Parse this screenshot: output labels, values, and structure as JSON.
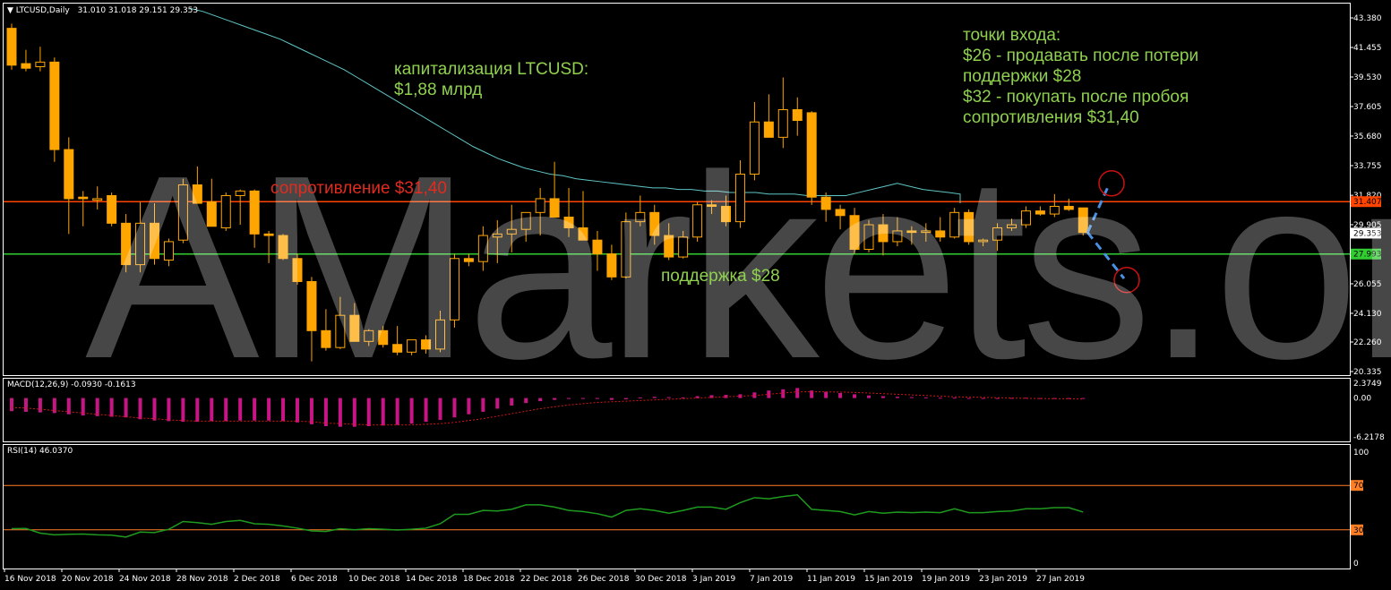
{
  "header": {
    "symbol_label": "LTCUSD,Daily",
    "ohlc": "31.010 31.018 29.151 29.353"
  },
  "watermark": "AMarkets.org",
  "annotations": {
    "cap_line1": "капитализация LTCUSD:",
    "cap_line2": "$1,88 млрд",
    "entry_lines": [
      "точки входа:",
      "$26 - продавать после потери",
      "поддержки $28",
      "$32 - покупать после пробоя",
      "сопротивления $31,40"
    ],
    "resistance_label": "сопротивление $31,40",
    "support_label": "поддержка $28"
  },
  "colors": {
    "bull_candle": "#000000",
    "candle": "#ffa500",
    "ma": "#5fc5c5",
    "resistance": "#ff4500",
    "support": "#32cd32",
    "macd_hist": "#c71585",
    "macd_signal": "#d01818",
    "rsi": "#1e9b1e",
    "rsi_levels": "#ff7f27",
    "axis_text": "#ffffff",
    "projection": "#4a90e2",
    "target_circle": "#cc1111"
  },
  "chart_data": [
    {
      "type": "candlestick",
      "panel": "price",
      "title": "LTCUSD,Daily",
      "ylim": [
        20.335,
        43.38
      ],
      "yticks": [
        "43.380",
        "41.455",
        "39.530",
        "37.605",
        "35.680",
        "33.755",
        "31.820",
        "29.905",
        "28.0",
        "26.055",
        "24.130",
        "22.260",
        "20.335"
      ],
      "ytick_values": [
        43.38,
        41.455,
        39.53,
        37.605,
        35.68,
        33.755,
        31.82,
        29.905,
        28.0,
        26.055,
        24.13,
        22.26,
        20.335
      ],
      "current_price": "29.353",
      "resistance": {
        "value": 31.407,
        "label": "31.407"
      },
      "support": {
        "value": 27.993,
        "label": "27.993"
      },
      "xticks": [
        "16 Nov 2018",
        "20 Nov 2018",
        "24 Nov 2018",
        "28 Nov 2018",
        "2 Dec 2018",
        "6 Dec 2018",
        "10 Dec 2018",
        "14 Dec 2018",
        "18 Dec 2018",
        "22 Dec 2018",
        "26 Dec 2018",
        "30 Dec 2018",
        "3 Jan 2019",
        "7 Jan 2019",
        "11 Jan 2019",
        "15 Jan 2019",
        "19 Jan 2019",
        "23 Jan 2019",
        "27 Jan 2019"
      ],
      "ohlc": [
        [
          42.7,
          43.0,
          40.0,
          40.3
        ],
        [
          40.4,
          41.3,
          39.9,
          40.1
        ],
        [
          40.2,
          41.5,
          39.9,
          40.5
        ],
        [
          40.5,
          40.8,
          34.0,
          34.8
        ],
        [
          34.8,
          35.6,
          29.3,
          31.6
        ],
        [
          31.7,
          32.1,
          29.8,
          31.6
        ],
        [
          31.5,
          32.4,
          30.9,
          31.6
        ],
        [
          31.8,
          32.0,
          29.8,
          30.0
        ],
        [
          30.0,
          30.6,
          26.8,
          27.3
        ],
        [
          27.3,
          31.4,
          26.8,
          30.0
        ],
        [
          30.0,
          31.3,
          27.3,
          27.7
        ],
        [
          27.6,
          29.0,
          27.2,
          28.8
        ],
        [
          28.9,
          32.9,
          28.7,
          32.5
        ],
        [
          32.5,
          33.7,
          31.9,
          31.3
        ],
        [
          31.4,
          32.9,
          29.8,
          29.8
        ],
        [
          29.7,
          32.0,
          29.5,
          31.8
        ],
        [
          31.8,
          32.2,
          29.9,
          32.1
        ],
        [
          32.1,
          32.2,
          28.4,
          29.3
        ],
        [
          29.3,
          29.5,
          27.4,
          29.2
        ],
        [
          29.2,
          29.3,
          27.6,
          27.7
        ],
        [
          27.7,
          28.0,
          26.0,
          26.2
        ],
        [
          26.2,
          26.5,
          21.0,
          23.0
        ],
        [
          23.0,
          24.4,
          21.7,
          21.9
        ],
        [
          21.9,
          25.2,
          21.8,
          24.0
        ],
        [
          24.0,
          24.8,
          22.5,
          22.3
        ],
        [
          22.3,
          23.1,
          22.0,
          23.0
        ],
        [
          23.0,
          23.3,
          21.9,
          22.1
        ],
        [
          22.1,
          23.3,
          21.4,
          21.6
        ],
        [
          21.6,
          22.1,
          21.4,
          22.4
        ],
        [
          22.4,
          22.7,
          21.5,
          21.8
        ],
        [
          21.8,
          24.3,
          21.6,
          23.7
        ],
        [
          23.7,
          28.0,
          23.2,
          27.7
        ],
        [
          27.7,
          28.0,
          27.2,
          27.5
        ],
        [
          27.5,
          29.8,
          26.9,
          29.2
        ],
        [
          29.1,
          30.2,
          27.4,
          29.3
        ],
        [
          29.3,
          31.2,
          28.1,
          29.6
        ],
        [
          29.6,
          29.9,
          28.8,
          30.7
        ],
        [
          30.7,
          32.3,
          29.2,
          31.6
        ],
        [
          31.6,
          34.0,
          31.0,
          30.4
        ],
        [
          30.4,
          32.3,
          29.1,
          29.7
        ],
        [
          29.7,
          32.1,
          28.9,
          28.9
        ],
        [
          28.9,
          29.5,
          26.9,
          28.0
        ],
        [
          28.0,
          28.6,
          26.3,
          26.5
        ],
        [
          26.5,
          30.7,
          26.4,
          30.1
        ],
        [
          30.1,
          31.8,
          29.8,
          30.7
        ],
        [
          30.7,
          31.2,
          28.6,
          29.2
        ],
        [
          29.2,
          30.0,
          27.6,
          27.8
        ],
        [
          27.8,
          29.5,
          27.7,
          29.1
        ],
        [
          29.1,
          31.4,
          28.8,
          31.2
        ],
        [
          31.2,
          31.5,
          30.6,
          31.1
        ],
        [
          31.1,
          31.8,
          29.8,
          30.1
        ],
        [
          30.1,
          34.1,
          29.7,
          33.2
        ],
        [
          33.2,
          37.9,
          32.8,
          36.6
        ],
        [
          36.6,
          38.4,
          35.7,
          35.6
        ],
        [
          35.6,
          39.5,
          34.9,
          37.4
        ],
        [
          37.4,
          38.2,
          35.7,
          36.7
        ],
        [
          37.2,
          37.3,
          31.2,
          31.7
        ],
        [
          31.7,
          32.0,
          30.1,
          30.9
        ],
        [
          30.9,
          31.2,
          29.6,
          30.5
        ],
        [
          30.5,
          31.0,
          28.0,
          28.3
        ],
        [
          28.3,
          30.2,
          28.1,
          29.9
        ],
        [
          29.9,
          30.6,
          27.9,
          28.8
        ],
        [
          28.8,
          30.4,
          28.5,
          29.5
        ],
        [
          29.5,
          29.8,
          28.6,
          29.4
        ],
        [
          29.4,
          30.0,
          28.8,
          29.5
        ],
        [
          29.5,
          30.4,
          28.8,
          29.1
        ],
        [
          29.1,
          31.0,
          29.0,
          30.7
        ],
        [
          30.7,
          30.9,
          28.6,
          28.8
        ],
        [
          28.8,
          29.0,
          28.5,
          28.9
        ],
        [
          28.9,
          30.0,
          28.2,
          29.7
        ],
        [
          29.7,
          30.3,
          29.5,
          29.9
        ],
        [
          29.9,
          31.1,
          29.7,
          30.8
        ],
        [
          30.8,
          31.1,
          30.5,
          30.6
        ],
        [
          30.6,
          31.9,
          30.4,
          31.1
        ],
        [
          31.1,
          31.6,
          30.8,
          30.9
        ],
        [
          31.0,
          31.0,
          29.2,
          29.4
        ]
      ],
      "ma_start": 40.8,
      "ma": [
        44.0,
        43.8,
        43.5,
        43.2,
        42.9,
        42.6,
        42.3,
        42.0,
        41.6,
        41.2,
        40.8,
        40.4,
        40.0,
        39.5,
        39.0,
        38.5,
        38.0,
        37.5,
        37.0,
        36.5,
        36.0,
        35.5,
        35.0,
        34.6,
        34.2,
        33.9,
        33.6,
        33.4,
        33.2,
        33.1,
        32.9,
        32.8,
        32.7,
        32.6,
        32.5,
        32.4,
        32.3,
        32.3,
        32.2,
        32.2,
        32.1,
        32.1,
        32.0,
        32.0,
        32.0,
        31.9,
        31.9,
        31.9,
        31.8,
        31.8,
        31.8,
        31.8,
        32.0,
        32.2,
        32.4,
        32.6,
        32.4,
        32.2,
        32.1,
        32.0,
        31.9,
        31.8,
        31.8,
        31.7,
        31.7,
        31.6,
        31.6,
        31.6,
        31.5,
        31.5,
        31.5,
        31.4,
        31.4,
        31.4,
        31.3,
        31.3
      ]
    },
    {
      "type": "histogram",
      "panel": "macd",
      "title": "MACD(12,26,9) -0.0930 -0.1613",
      "ylim": [
        -6.2178,
        2.3749
      ],
      "yticks": [
        "2.3749",
        "0.00",
        "-6.2178"
      ],
      "values": [
        -2.1,
        -2.2,
        -2.3,
        -2.4,
        -2.6,
        -2.8,
        -2.9,
        -3.0,
        -3.1,
        -3.4,
        -3.6,
        -3.7,
        -3.8,
        -3.8,
        -3.7,
        -3.7,
        -3.6,
        -3.6,
        -3.6,
        -3.7,
        -3.9,
        -4.2,
        -4.5,
        -4.6,
        -4.6,
        -4.5,
        -4.4,
        -4.3,
        -4.1,
        -3.8,
        -3.5,
        -3.1,
        -2.6,
        -2.2,
        -1.7,
        -1.2,
        -0.8,
        -0.5,
        -0.3,
        -0.15,
        -0.1,
        -0.15,
        -0.3,
        -0.2,
        0.1,
        0.2,
        0.15,
        0.1,
        0.3,
        0.45,
        0.5,
        0.6,
        0.9,
        1.2,
        1.4,
        1.6,
        1.2,
        1.0,
        0.8,
        0.6,
        0.4,
        0.3,
        0.2,
        0.15,
        0.1,
        0.05,
        0.05,
        -0.05,
        -0.08,
        -0.05,
        0.02,
        0.05,
        0.0,
        -0.05,
        -0.08,
        -0.09
      ],
      "signal": [
        -1.5,
        -1.6,
        -1.8,
        -2.0,
        -2.2,
        -2.4,
        -2.6,
        -2.8,
        -3.0,
        -3.2,
        -3.3,
        -3.5,
        -3.6,
        -3.7,
        -3.7,
        -3.7,
        -3.7,
        -3.7,
        -3.7,
        -3.7,
        -3.7,
        -3.8,
        -4.0,
        -4.1,
        -4.2,
        -4.3,
        -4.3,
        -4.3,
        -4.3,
        -4.2,
        -4.1,
        -3.9,
        -3.6,
        -3.3,
        -2.9,
        -2.5,
        -2.1,
        -1.7,
        -1.4,
        -1.1,
        -0.9,
        -0.7,
        -0.6,
        -0.5,
        -0.4,
        -0.3,
        -0.2,
        -0.1,
        0.0,
        0.1,
        0.2,
        0.3,
        0.4,
        0.6,
        0.8,
        1.0,
        1.0,
        1.0,
        0.95,
        0.9,
        0.8,
        0.7,
        0.6,
        0.5,
        0.4,
        0.3,
        0.2,
        0.15,
        0.1,
        0.05,
        0.0,
        -0.05,
        -0.08,
        -0.1,
        -0.12,
        -0.16
      ]
    },
    {
      "type": "line",
      "panel": "rsi",
      "title": "RSI(14) 46.0370",
      "ylim": [
        0,
        100
      ],
      "yticks": [
        "100",
        "70",
        "30",
        "0"
      ],
      "levels": [
        70,
        30
      ],
      "values": [
        31.0,
        31.2,
        27.0,
        25.5,
        26.0,
        26.2,
        25.5,
        25.2,
        23.5,
        28.0,
        27.5,
        30.5,
        37.5,
        36.5,
        35.0,
        37.5,
        38.5,
        35.5,
        35.0,
        33.5,
        31.5,
        29.0,
        28.5,
        31.0,
        30.0,
        31.0,
        30.5,
        29.8,
        30.5,
        31.5,
        35.5,
        44.0,
        44.0,
        47.5,
        47.0,
        48.5,
        52.5,
        52.5,
        50.5,
        47.5,
        46.5,
        44.5,
        41.5,
        47.5,
        49.0,
        47.5,
        45.0,
        47.5,
        50.5,
        50.5,
        48.5,
        54.5,
        59.0,
        58.0,
        60.0,
        61.5,
        48.5,
        47.5,
        46.5,
        43.5,
        46.5,
        45.0,
        46.0,
        45.5,
        46.0,
        45.5,
        49.0,
        45.5,
        45.5,
        46.5,
        47.0,
        49.0,
        49.0,
        50.0,
        50.0,
        46.0
      ]
    }
  ]
}
